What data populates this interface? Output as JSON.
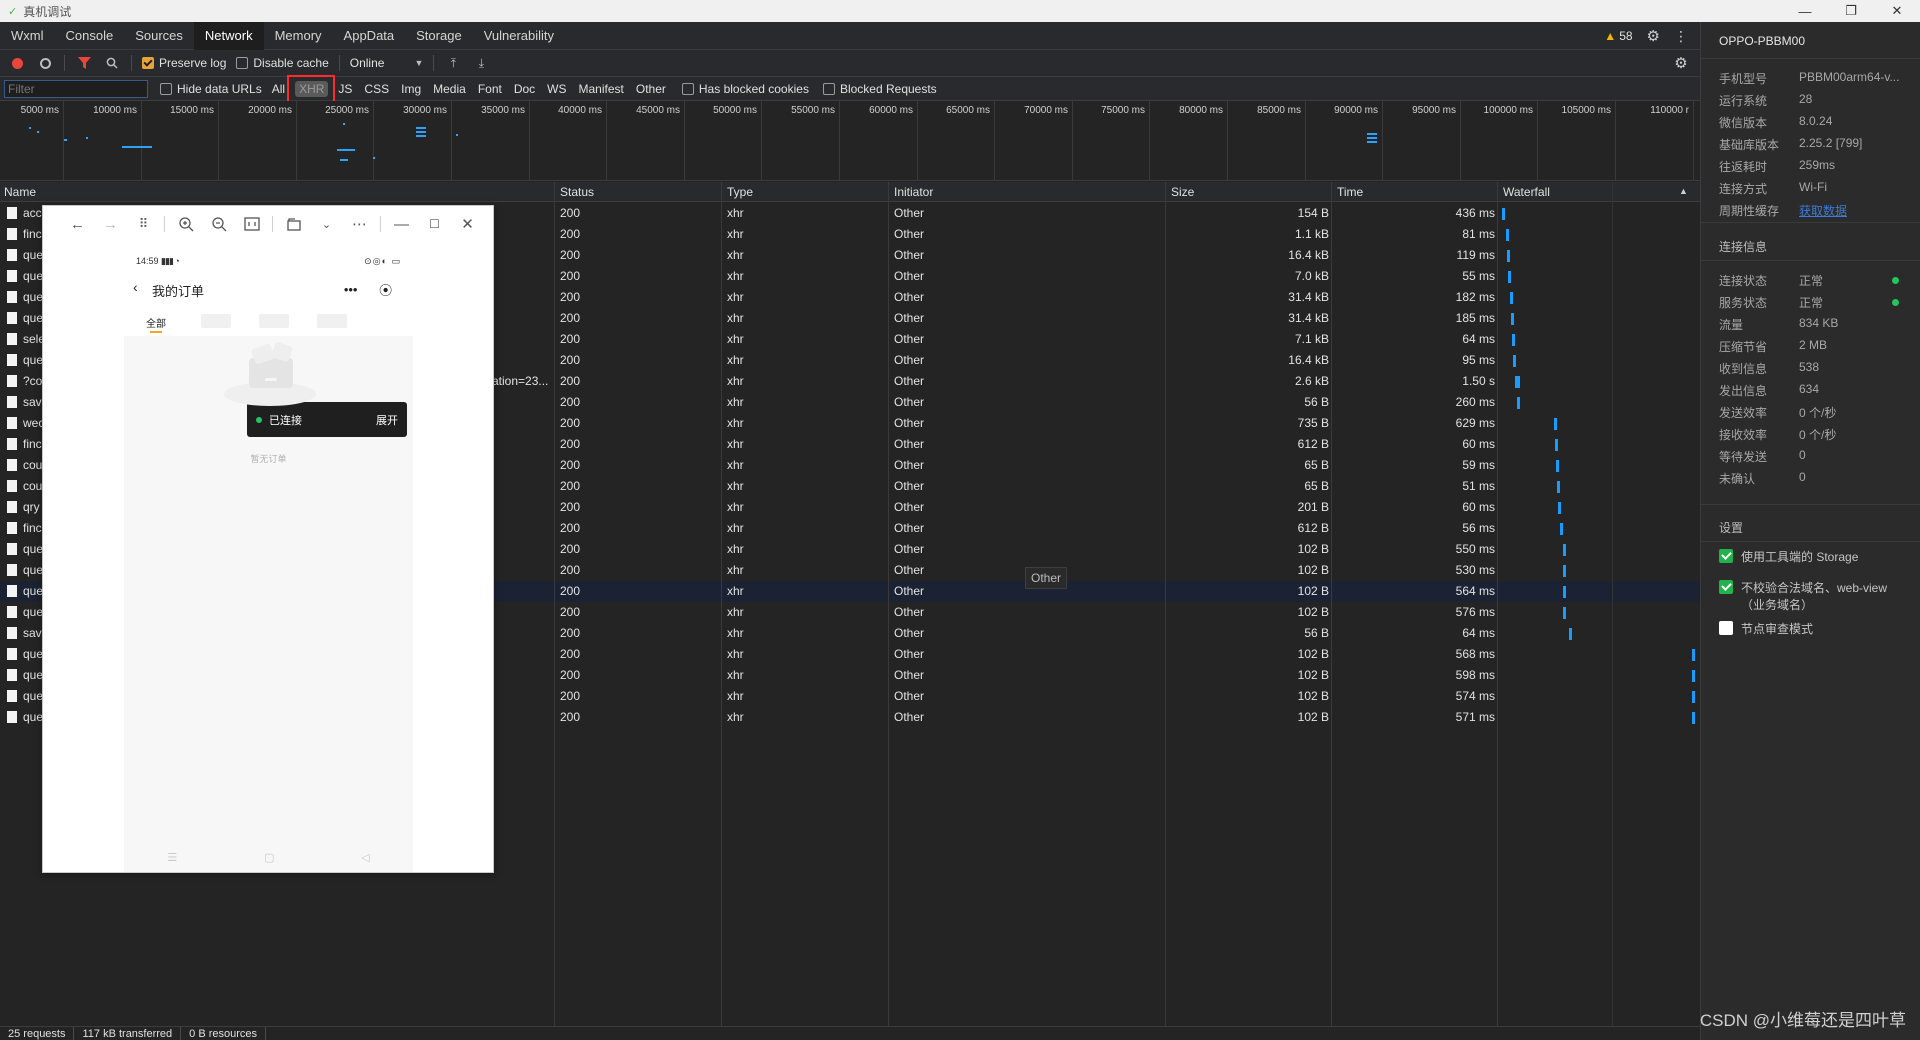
{
  "titlebar": {
    "title": "真机调试"
  },
  "devtools": {
    "tabs": [
      "Wxml",
      "Console",
      "Sources",
      "Network",
      "Memory",
      "AppData",
      "Storage",
      "Vulnerability"
    ],
    "active_tab": "Network",
    "warnings": "58"
  },
  "toolbar": {
    "preserve_log": "Preserve log",
    "disable_cache": "Disable cache",
    "throttle": "Online"
  },
  "filterbar": {
    "filter_placeholder": "Filter",
    "hide_data_urls": "Hide data URLs",
    "types": [
      "All",
      "XHR",
      "JS",
      "CSS",
      "Img",
      "Media",
      "Font",
      "Doc",
      "WS",
      "Manifest",
      "Other"
    ],
    "has_blocked_cookies": "Has blocked cookies",
    "blocked_requests": "Blocked Requests"
  },
  "overview": {
    "ticks": [
      "5000 ms",
      "10000 ms",
      "15000 ms",
      "20000 ms",
      "25000 ms",
      "30000 ms",
      "35000 ms",
      "40000 ms",
      "45000 ms",
      "50000 ms",
      "55000 ms",
      "60000 ms",
      "65000 ms",
      "70000 ms",
      "75000 ms",
      "80000 ms",
      "85000 ms",
      "90000 ms",
      "95000 ms",
      "100000 ms",
      "105000 ms",
      "110000 r"
    ]
  },
  "table": {
    "columns": [
      "Name",
      "Status",
      "Type",
      "Initiator",
      "Size",
      "Time",
      "Waterfall"
    ],
    "rows": [
      {
        "name": "acc",
        "status": "200",
        "type": "xhr",
        "initiator": "Other",
        "size": "154 B",
        "time": "436 ms",
        "wf": 0.002
      },
      {
        "name": "finc",
        "status": "200",
        "type": "xhr",
        "initiator": "Other",
        "size": "1.1 kB",
        "time": "81 ms",
        "wf": 0.02
      },
      {
        "name": "que",
        "status": "200",
        "type": "xhr",
        "initiator": "Other",
        "size": "16.4 kB",
        "time": "119 ms",
        "wf": 0.025
      },
      {
        "name": "que",
        "status": "200",
        "type": "xhr",
        "initiator": "Other",
        "size": "7.0 kB",
        "time": "55 ms",
        "wf": 0.03
      },
      {
        "name": "que",
        "status": "200",
        "type": "xhr",
        "initiator": "Other",
        "size": "31.4 kB",
        "time": "182 ms",
        "wf": 0.04
      },
      {
        "name": "que",
        "status": "200",
        "type": "xhr",
        "initiator": "Other",
        "size": "31.4 kB",
        "time": "185 ms",
        "wf": 0.045
      },
      {
        "name": "sele",
        "status": "200",
        "type": "xhr",
        "initiator": "Other",
        "size": "7.1 kB",
        "time": "64 ms",
        "wf": 0.05
      },
      {
        "name": "que",
        "status": "200",
        "type": "xhr",
        "initiator": "Other",
        "size": "16.4 kB",
        "time": "95 ms",
        "wf": 0.055
      },
      {
        "name": "?co",
        "name_tail": "ation=23...",
        "status": "200",
        "type": "xhr",
        "initiator": "Other",
        "size": "2.6 kB",
        "time": "1.50 s",
        "wf": 0.07
      },
      {
        "name": "sav",
        "status": "200",
        "type": "xhr",
        "initiator": "Other",
        "size": "56 B",
        "time": "260 ms",
        "wf": 0.08
      },
      {
        "name": "wec",
        "status": "200",
        "type": "xhr",
        "initiator": "Other",
        "size": "735 B",
        "time": "629 ms",
        "wf": 0.27
      },
      {
        "name": "finc",
        "status": "200",
        "type": "xhr",
        "initiator": "Other",
        "size": "612 B",
        "time": "60 ms",
        "wf": 0.275
      },
      {
        "name": "cou",
        "status": "200",
        "type": "xhr",
        "initiator": "Other",
        "size": "65 B",
        "time": "59 ms",
        "wf": 0.28
      },
      {
        "name": "cou",
        "status": "200",
        "type": "xhr",
        "initiator": "Other",
        "size": "65 B",
        "time": "51 ms",
        "wf": 0.285
      },
      {
        "name": "qry",
        "status": "200",
        "type": "xhr",
        "initiator": "Other",
        "size": "201 B",
        "time": "60 ms",
        "wf": 0.29
      },
      {
        "name": "finc",
        "status": "200",
        "type": "xhr",
        "initiator": "Other",
        "size": "612 B",
        "time": "56 ms",
        "wf": 0.3
      },
      {
        "name": "que",
        "status": "200",
        "type": "xhr",
        "initiator": "Other",
        "size": "102 B",
        "time": "550 ms",
        "wf": 0.32
      },
      {
        "name": "que",
        "status": "200",
        "type": "xhr",
        "initiator": "Other",
        "size": "102 B",
        "time": "530 ms",
        "wf": 0.32
      },
      {
        "name": "que",
        "status": "200",
        "type": "xhr",
        "initiator": "Other",
        "size": "102 B",
        "time": "564 ms",
        "wf": 0.32,
        "selected": true
      },
      {
        "name": "que",
        "status": "200",
        "type": "xhr",
        "initiator": "Other",
        "size": "102 B",
        "time": "576 ms",
        "wf": 0.32
      },
      {
        "name": "sav",
        "status": "200",
        "type": "xhr",
        "initiator": "Other",
        "size": "56 B",
        "time": "64 ms",
        "wf": 0.35
      },
      {
        "name": "que",
        "status": "200",
        "type": "xhr",
        "initiator": "Other",
        "size": "102 B",
        "time": "568 ms",
        "wf": 0.99
      },
      {
        "name": "que",
        "status": "200",
        "type": "xhr",
        "initiator": "Other",
        "size": "102 B",
        "time": "598 ms",
        "wf": 0.99
      },
      {
        "name": "que",
        "status": "200",
        "type": "xhr",
        "initiator": "Other",
        "size": "102 B",
        "time": "574 ms",
        "wf": 0.99
      },
      {
        "name": "que",
        "status": "200",
        "type": "xhr",
        "initiator": "Other",
        "size": "102 B",
        "time": "571 ms",
        "wf": 0.99
      }
    ]
  },
  "tooltip": "Other",
  "statusbar": {
    "requests": "25 requests",
    "transferred": "117 kB transferred",
    "resources": "0 B resources"
  },
  "rpanel": {
    "device": "OPPO-PBBM00",
    "info": [
      {
        "k": "手机型号",
        "v": "PBBM00arm64-v..."
      },
      {
        "k": "运行系统",
        "v": "28"
      },
      {
        "k": "微信版本",
        "v": "8.0.24"
      },
      {
        "k": "基础库版本",
        "v": "2.25.2 [799]"
      },
      {
        "k": "往返耗时",
        "v": "259ms"
      },
      {
        "k": "连接方式",
        "v": "Wi-Fi"
      },
      {
        "k": "周期性缓存",
        "v": "获取数据",
        "link": true
      }
    ],
    "conn_title": "连接信息",
    "conn": [
      {
        "k": "连接状态",
        "v": "正常",
        "dot": true
      },
      {
        "k": "服务状态",
        "v": "正常",
        "dot": true
      },
      {
        "k": "流量",
        "v": "834 KB"
      },
      {
        "k": "压缩节省",
        "v": "2 MB"
      },
      {
        "k": "收到信息",
        "v": "538"
      },
      {
        "k": "发出信息",
        "v": "634"
      },
      {
        "k": "发送效率",
        "v": "0 个/秒"
      },
      {
        "k": "接收效率",
        "v": "0 个/秒"
      },
      {
        "k": "等待发送",
        "v": "0"
      },
      {
        "k": "未确认",
        "v": "0"
      }
    ],
    "settings_title": "设置",
    "settings": [
      {
        "label": "使用工具端的 Storage",
        "checked": true
      },
      {
        "label": "不校验合法域名、web-view（业务域名）",
        "checked": true
      },
      {
        "label": "节点审查模式",
        "checked": false
      }
    ]
  },
  "phone": {
    "time": "14:59",
    "title": "我的订单",
    "tab_all": "全部",
    "toast_text": "已连接",
    "toast_action": "展开",
    "empty_text": "暂无订单"
  },
  "watermark": "CSDN @小维莓还是四叶草",
  "colors": {
    "accent": "#1a9cff",
    "ok": "#22c55e",
    "highlight_box": "#ff2a2a"
  }
}
